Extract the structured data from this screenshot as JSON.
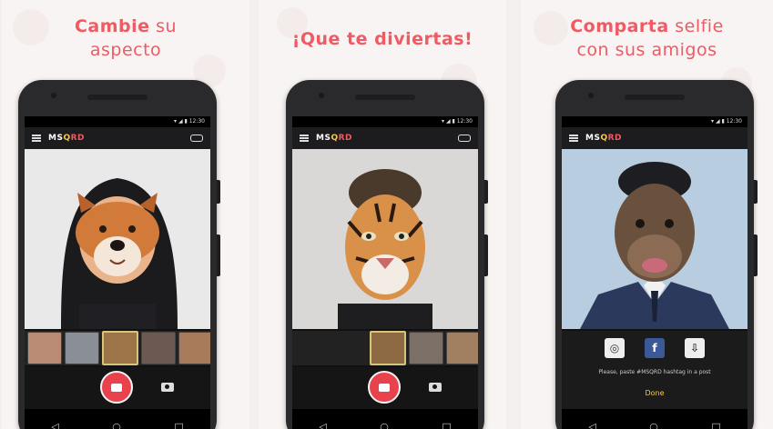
{
  "panels": [
    {
      "caption_bold": "Cambie",
      "caption_rest": " su",
      "caption_line2": "aspecto",
      "status": "▾ ◢ ▮ 12:30",
      "logo": [
        "MS",
        "Q",
        "RD"
      ],
      "filter": "dog"
    },
    {
      "caption_bold": "¡Que te diviertas!",
      "caption_rest": "",
      "caption_line2": "",
      "status": "▾ ◢ ▮ 12:30",
      "logo": [
        "MS",
        "Q",
        "RD"
      ],
      "filter": "tiger"
    },
    {
      "caption_bold": "Comparta",
      "caption_rest": " selfie",
      "caption_line2": "con sus amigos",
      "status": "▾ ◢ ▮ 12:30",
      "logo": [
        "MS",
        "Q",
        "RD"
      ],
      "filter": "monkey",
      "share_text": "Please, paste #MSQRD hashtag in a post",
      "done_label": "Done"
    }
  ],
  "navbar": {
    "back": "◁",
    "home": "○",
    "recent": "□"
  },
  "colors": {
    "accent": "#ef5a63",
    "record": "#e8434d",
    "logo_yellow": "#f7c948"
  }
}
